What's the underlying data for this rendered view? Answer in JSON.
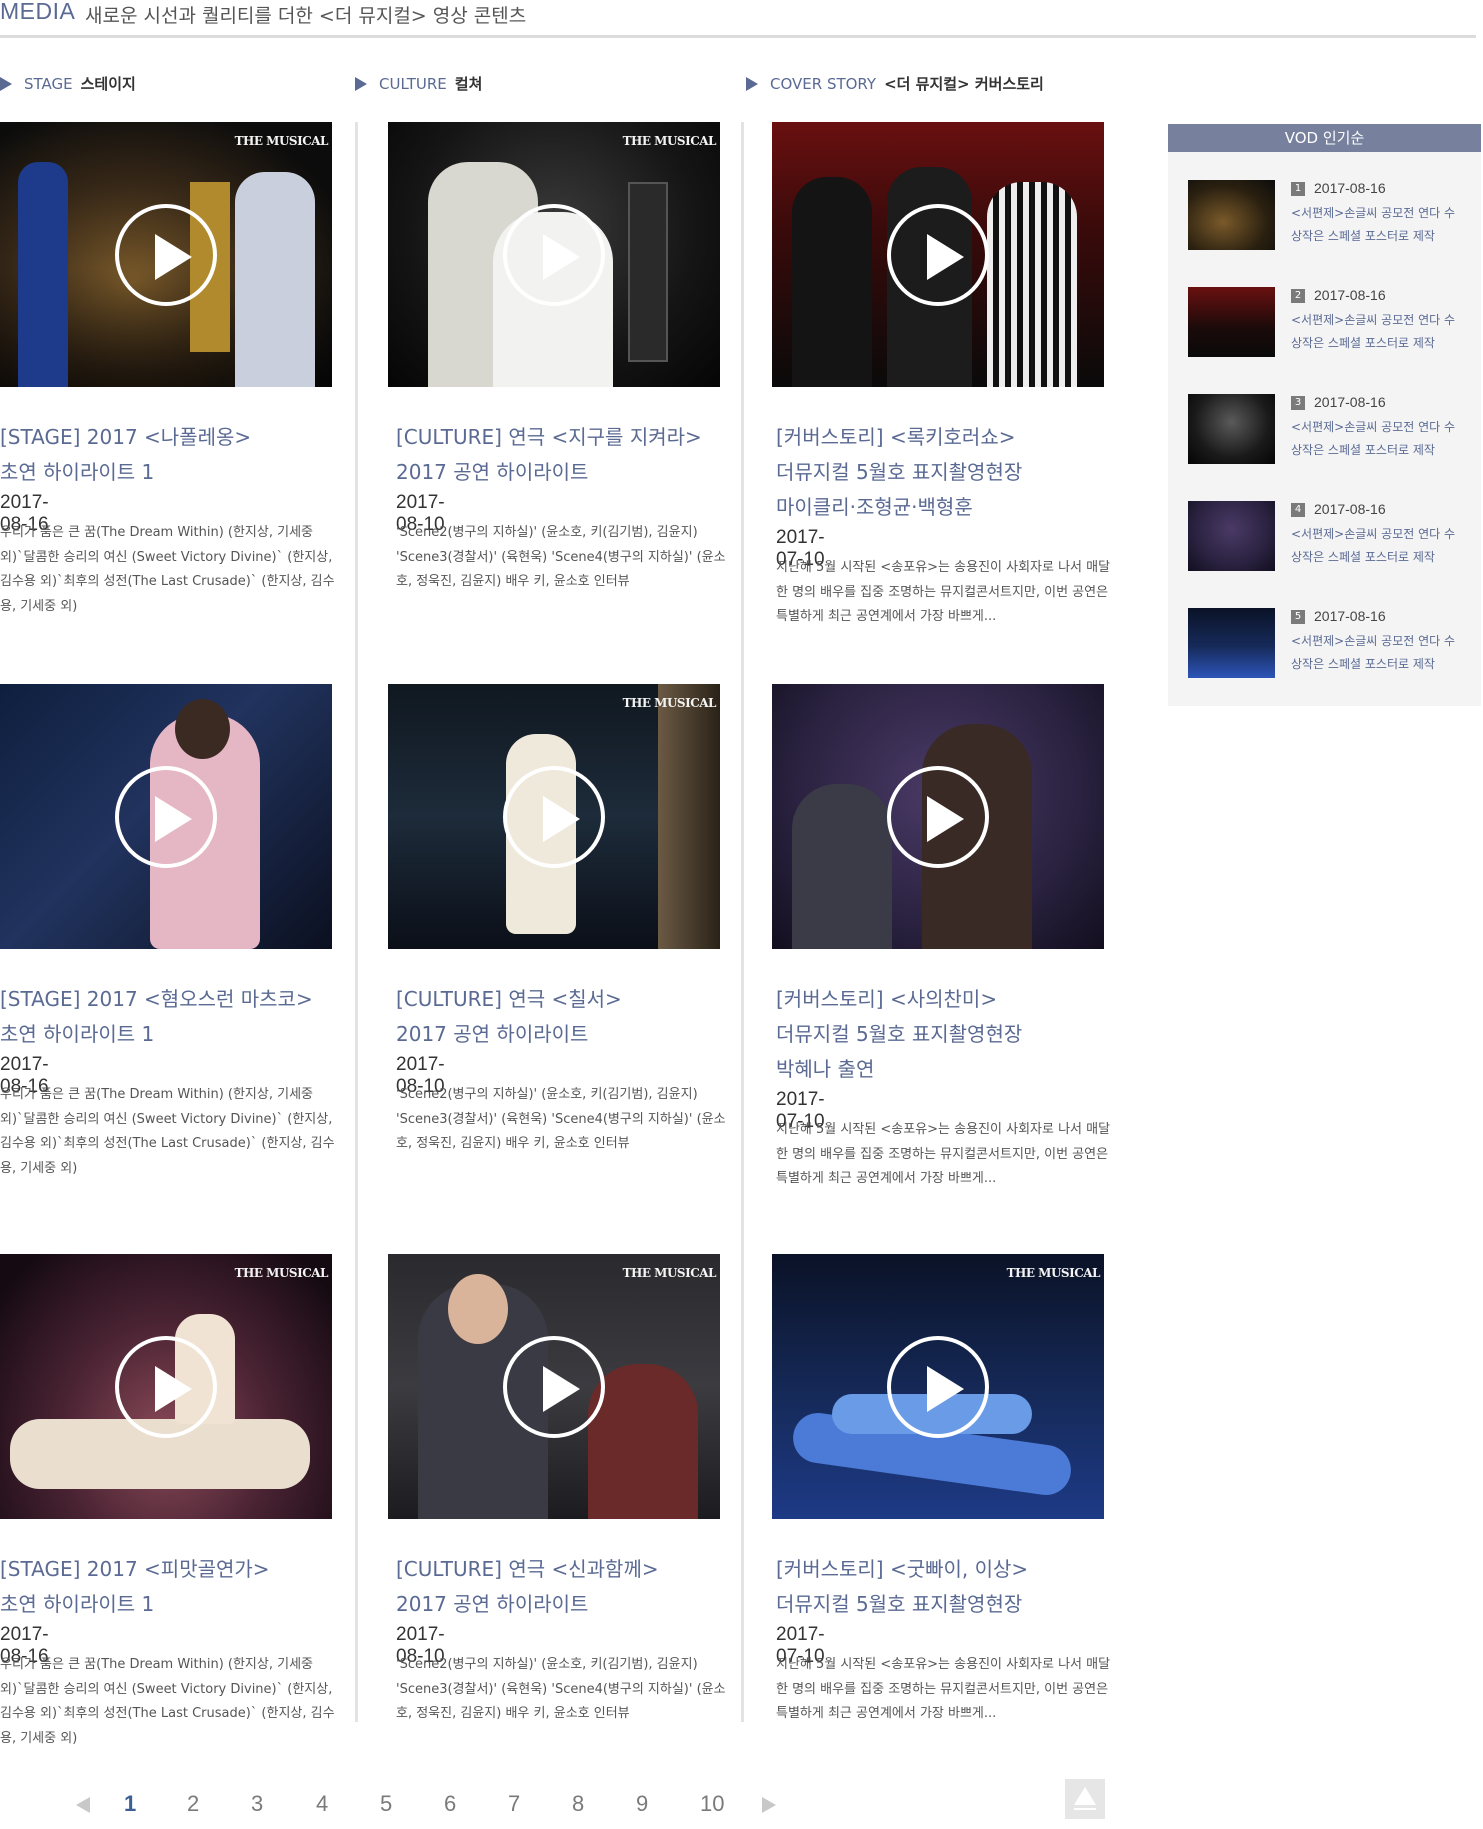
{
  "header": {
    "media_label": "MEDIA",
    "subtitle": "새로운 시선과 퀄리티를 더한 <더 뮤지컬> 영상 콘텐츠"
  },
  "categories": [
    {
      "en": "STAGE",
      "ko": "스테이지"
    },
    {
      "en": "CULTURE",
      "ko": "컬쳐"
    },
    {
      "en": "COVER STORY",
      "ko": "<더 뮤지컬> 커버스토리"
    }
  ],
  "brand_mark": "THE MUSICAL",
  "columns": [
    {
      "cards": [
        {
          "title": "[STAGE] 2017 <나폴레옹>\n초연 하이라이트 1",
          "date": "2017-08-16",
          "desc": "우리가 품은 큰 꿈(The Dream Within) (한지상, 기세중 외)`달콤한 승리의 여신 (Sweet Victory Divine)` (한지상, 김수용 외)`최후의 성전(The Last Crusade)` (한지상, 김수용, 기세중 외)"
        },
        {
          "title": "[STAGE] 2017 <혐오스런 마츠코>\n초연 하이라이트 1",
          "date": "2017-08-16",
          "desc": "우리가 품은 큰 꿈(The Dream Within) (한지상, 기세중 외)`달콤한 승리의 여신 (Sweet Victory Divine)` (한지상, 김수용 외)`최후의 성전(The Last Crusade)` (한지상, 김수용, 기세중 외)"
        },
        {
          "title": "[STAGE] 2017 <피맛골연가>\n초연 하이라이트 1",
          "date": "2017-08-16",
          "desc": "우리가 품은 큰 꿈(The Dream Within) (한지상, 기세중 외)`달콤한 승리의 여신 (Sweet Victory Divine)` (한지상, 김수용 외)`최후의 성전(The Last Crusade)` (한지상, 김수용, 기세중 외)"
        }
      ]
    },
    {
      "cards": [
        {
          "title": "[CULTURE] 연극 <지구를 지켜라>\n2017 공연 하이라이트",
          "date": "2017-08-10",
          "desc": "'Scene2(병구의 지하실)' (윤소호, 키(김기범), 김윤지) 'Scene3(경찰서)' (육현욱) 'Scene4(병구의 지하실)' (윤소호, 정욱진, 김윤지) 배우 키, 윤소호 인터뷰"
        },
        {
          "title": "[CULTURE] 연극 <칠서>\n 2017 공연 하이라이트",
          "date": "2017-08-10",
          "desc": "'Scene2(병구의 지하실)' (윤소호, 키(김기범), 김윤지) 'Scene3(경찰서)' (육현욱) 'Scene4(병구의 지하실)' (윤소호, 정욱진, 김윤지) 배우 키, 윤소호 인터뷰"
        },
        {
          "title": "[CULTURE] 연극 <신과함께>\n2017 공연 하이라이트",
          "date": "2017-08-10",
          "desc": "'Scene2(병구의 지하실)' (윤소호, 키(김기범), 김윤지) 'Scene3(경찰서)' (육현욱) 'Scene4(병구의 지하실)' (윤소호, 정욱진, 김윤지) 배우 키, 윤소호 인터뷰"
        }
      ]
    },
    {
      "cards": [
        {
          "title": "[커버스토리] <록키호러쇼>\n더뮤지컬 5월호 표지촬영현장\n마이클리·조형균·백형훈",
          "date": "2017-07-10",
          "desc": "지난해 5월 시작된 <송포유>는 송용진이 사회자로 나서 매달 한 명의 배우를 집중 조명하는 뮤지컬콘서트지만, 이번 공연은 특별하게 최근 공연계에서 가장 바쁘게..."
        },
        {
          "title": "[커버스토리] <사의찬미>\n더뮤지컬 5월호 표지촬영현장\n박혜나 출연",
          "date": "2017-07-10",
          "desc": "지난해 5월 시작된 <송포유>는 송용진이 사회자로 나서 매달 한 명의 배우를 집중 조명하는 뮤지컬콘서트지만, 이번 공연은 특별하게 최근 공연계에서 가장 바쁘게..."
        },
        {
          "title": "[커버스토리] <굿빠이, 이상>\n더뮤지컬 5월호 표지촬영현장",
          "date": "2017-07-10",
          "desc": "지난해 5월 시작된 <송포유>는 송용진이 사회자로 나서 매달 한 명의 배우를 집중 조명하는 뮤지컬콘서트지만, 이번 공연은 특별하게 최근 공연계에서 가장 바쁘게..."
        }
      ]
    }
  ],
  "vod": {
    "heading": "VOD 인기순",
    "items": [
      {
        "rank": "1",
        "date": "2017-08-16",
        "title": "<서편제>손글씨 공모전 연다 수상작은 스페셜 포스터로 제작"
      },
      {
        "rank": "2",
        "date": "2017-08-16",
        "title": "<서편제>손글씨 공모전 연다 수상작은 스페셜 포스터로 제작"
      },
      {
        "rank": "3",
        "date": "2017-08-16",
        "title": "<서편제>손글씨 공모전 연다 수상작은 스페셜 포스터로 제작"
      },
      {
        "rank": "4",
        "date": "2017-08-16",
        "title": "<서편제>손글씨 공모전 연다 수상작은 스페셜 포스터로 제작"
      },
      {
        "rank": "5",
        "date": "2017-08-16",
        "title": "<서편제>손글씨 공모전 연다 수상작은 스페셜 포스터로 제작"
      }
    ]
  },
  "pagination": {
    "pages": [
      "1",
      "2",
      "3",
      "4",
      "5",
      "6",
      "7",
      "8",
      "9",
      "10"
    ],
    "current": "1"
  },
  "icons": {
    "play": "play-icon",
    "prev": "chevron-left-icon",
    "next": "chevron-right-icon",
    "top": "scroll-top-icon",
    "category": "triangle-right-icon"
  }
}
